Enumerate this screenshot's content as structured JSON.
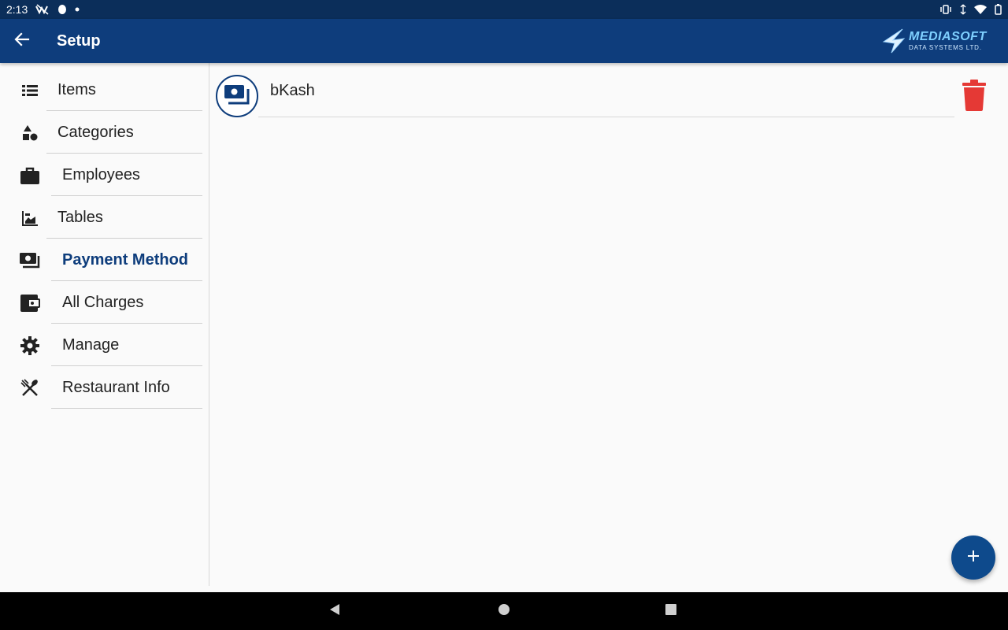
{
  "status_bar": {
    "time": "2:13"
  },
  "app_bar": {
    "title": "Setup",
    "logo_main": "MEDIASOFT",
    "logo_sub": "DATA SYSTEMS LTD."
  },
  "sidebar": {
    "items": [
      {
        "label": "Items",
        "icon": "list-icon"
      },
      {
        "label": "Categories",
        "icon": "shapes-icon"
      },
      {
        "label": "Employees",
        "icon": "briefcase-icon"
      },
      {
        "label": "Tables",
        "icon": "table-icon"
      },
      {
        "label": "Payment Method",
        "icon": "payments-icon",
        "active": true
      },
      {
        "label": "All Charges",
        "icon": "wallet-icon"
      },
      {
        "label": "Manage",
        "icon": "gear-icon"
      },
      {
        "label": "Restaurant Info",
        "icon": "utensils-icon"
      }
    ]
  },
  "main": {
    "payment_methods": [
      {
        "name": "bKash"
      }
    ]
  },
  "colors": {
    "primary": "#0e3d7c",
    "status_bar": "#0b2e5a",
    "delete": "#e53935",
    "fab": "#0e4a8c"
  }
}
